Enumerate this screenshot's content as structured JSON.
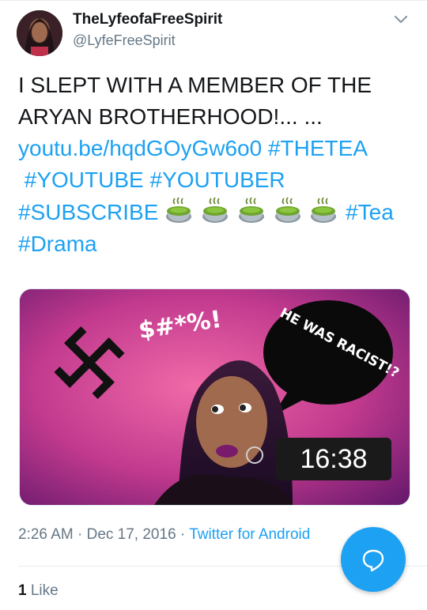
{
  "author": {
    "name": "TheLyfeofaFreeSpirit",
    "handle": "@LyfeFreeSpirit"
  },
  "tweet": {
    "line1": "I SLEPT WITH A MEMBER OF THE",
    "line2": "ARYAN BROTHERHOOD!... ...",
    "link": "youtu.be/hqdGOyGw6o0",
    "tag_thetea": "#THETEA",
    "tag_youtube": "#YOUTUBE",
    "tag_youtuber": "#YOUTUBER",
    "tag_subscribe": "#SUBSCRIBE",
    "tag_tea": "#Tea",
    "tag_drama": "#Drama"
  },
  "media": {
    "overlay_text": "$#*%!",
    "bubble_text": "HE WAS RACIST!?",
    "duration": "16:38"
  },
  "meta": {
    "time": "2:26 AM",
    "sep1": " · ",
    "date": "Dec 17, 2016",
    "sep2": " · ",
    "source": "Twitter for Android"
  },
  "stats": {
    "likes_count": "1",
    "likes_label": "Like"
  },
  "colors": {
    "accent": "#1da1f2",
    "text": "#14171a",
    "muted": "#657786"
  },
  "icons": {
    "more": "chevron-down-icon",
    "tea": "teacup-icon",
    "compose": "reply-bubble-icon"
  }
}
